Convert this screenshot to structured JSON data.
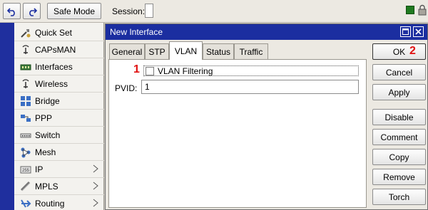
{
  "toolbar": {
    "undo_icon": "undo-icon",
    "redo_icon": "redo-icon",
    "safe_mode_label": "Safe Mode",
    "session_label": "Session:",
    "session_value": ""
  },
  "sidebar": {
    "items": [
      {
        "label": "Quick Set",
        "icon": "quick-set-icon",
        "submenu": false
      },
      {
        "label": "CAPsMAN",
        "icon": "capsman-icon",
        "submenu": false
      },
      {
        "label": "Interfaces",
        "icon": "interfaces-icon",
        "submenu": false
      },
      {
        "label": "Wireless",
        "icon": "wireless-icon",
        "submenu": false
      },
      {
        "label": "Bridge",
        "icon": "bridge-icon",
        "submenu": false
      },
      {
        "label": "PPP",
        "icon": "ppp-icon",
        "submenu": false
      },
      {
        "label": "Switch",
        "icon": "switch-icon",
        "submenu": false
      },
      {
        "label": "Mesh",
        "icon": "mesh-icon",
        "submenu": false
      },
      {
        "label": "IP",
        "icon": "ip-icon",
        "submenu": true
      },
      {
        "label": "MPLS",
        "icon": "mpls-icon",
        "submenu": true
      },
      {
        "label": "Routing",
        "icon": "routing-icon",
        "submenu": true
      }
    ]
  },
  "dialog": {
    "title": "New Interface",
    "tabs": [
      {
        "label": "General",
        "active": false
      },
      {
        "label": "STP",
        "active": false
      },
      {
        "label": "VLAN",
        "active": true
      },
      {
        "label": "Status",
        "active": false
      },
      {
        "label": "Traffic",
        "active": false
      }
    ],
    "vlan_filtering_label": "VLAN Filtering",
    "vlan_filtering_checked": false,
    "pvid_label": "PVID:",
    "pvid_value": "1",
    "annotation_1": "1",
    "annotation_2": "2",
    "buttons": {
      "ok": "OK",
      "cancel": "Cancel",
      "apply": "Apply",
      "disable": "Disable",
      "comment": "Comment",
      "copy": "Copy",
      "remove": "Remove",
      "torch": "Torch"
    }
  },
  "colors": {
    "title_bar": "#1b2ea0",
    "left_strip": "#1f2f9e",
    "annotation": "#e01010",
    "status_green": "#1f7a1f"
  }
}
